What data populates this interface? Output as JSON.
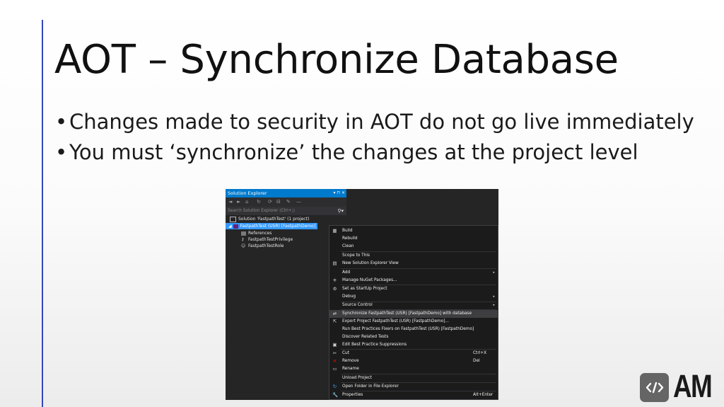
{
  "slide": {
    "title": "AOT – Synchronize Database",
    "bullets": [
      "Changes made to security in AOT do not go live immediately",
      "You must ‘synchronize’ the changes at the project level"
    ],
    "accent_color": "#3447b8"
  },
  "screenshot": {
    "panel_title": "Solution Explorer",
    "window_buttons": "▾ ⊓ ✕",
    "search_placeholder": "Search Solution Explorer (Ctrl+;)",
    "tree": [
      {
        "label": "Solution 'FastpathTest' (1 project)",
        "icon": "solution-icon"
      },
      {
        "label": "FastpathTest (USR) [FastpathDemo]",
        "icon": "project-icon",
        "selected": true
      },
      {
        "label": "References",
        "icon": "references-icon"
      },
      {
        "label": "FastpathTestPrivilege",
        "icon": "privilege-icon"
      },
      {
        "label": "FastpathTestRole",
        "icon": "role-icon"
      }
    ],
    "context_menu": [
      {
        "label": "Build",
        "icon": "build-icon"
      },
      {
        "label": "Rebuild"
      },
      {
        "label": "Clean"
      },
      {
        "label": "Scope to This"
      },
      {
        "label": "New Solution Explorer View",
        "icon": "new-view-icon"
      },
      {
        "label": "Add",
        "submenu": true
      },
      {
        "label": "Manage NuGet Packages...",
        "icon": "nuget-icon"
      },
      {
        "label": "Set as StartUp Project",
        "icon": "gear-icon"
      },
      {
        "label": "Debug",
        "submenu": true
      },
      {
        "label": "Source Control",
        "submenu": true
      },
      {
        "label": "Synchronize FastpathTest (USR) [FastpathDemo] with database",
        "icon": "sync-icon",
        "highlighted": true
      },
      {
        "label": "Export Project FastpathTest (USR) [FastpathDemo]...",
        "icon": "export-icon"
      },
      {
        "label": "Run Best Practices Fixers on FastpathTest (USR) [FastpathDemo]"
      },
      {
        "label": "Discover Related Tests"
      },
      {
        "label": "Edit Best Practice Suppressions",
        "icon": "edit-icon"
      },
      {
        "label": "Cut",
        "shortcut": "Ctrl+X",
        "icon": "cut-icon"
      },
      {
        "label": "Remove",
        "shortcut": "Del",
        "icon": "remove-icon"
      },
      {
        "label": "Rename",
        "icon": "rename-icon"
      },
      {
        "label": "Unload Project"
      },
      {
        "label": "Open Folder in File Explorer",
        "icon": "folder-icon"
      },
      {
        "label": "Properties",
        "shortcut": "Alt+Enter",
        "icon": "wrench-icon"
      }
    ]
  },
  "logo": {
    "text": "AM",
    "icon": "code-brackets-icon"
  }
}
